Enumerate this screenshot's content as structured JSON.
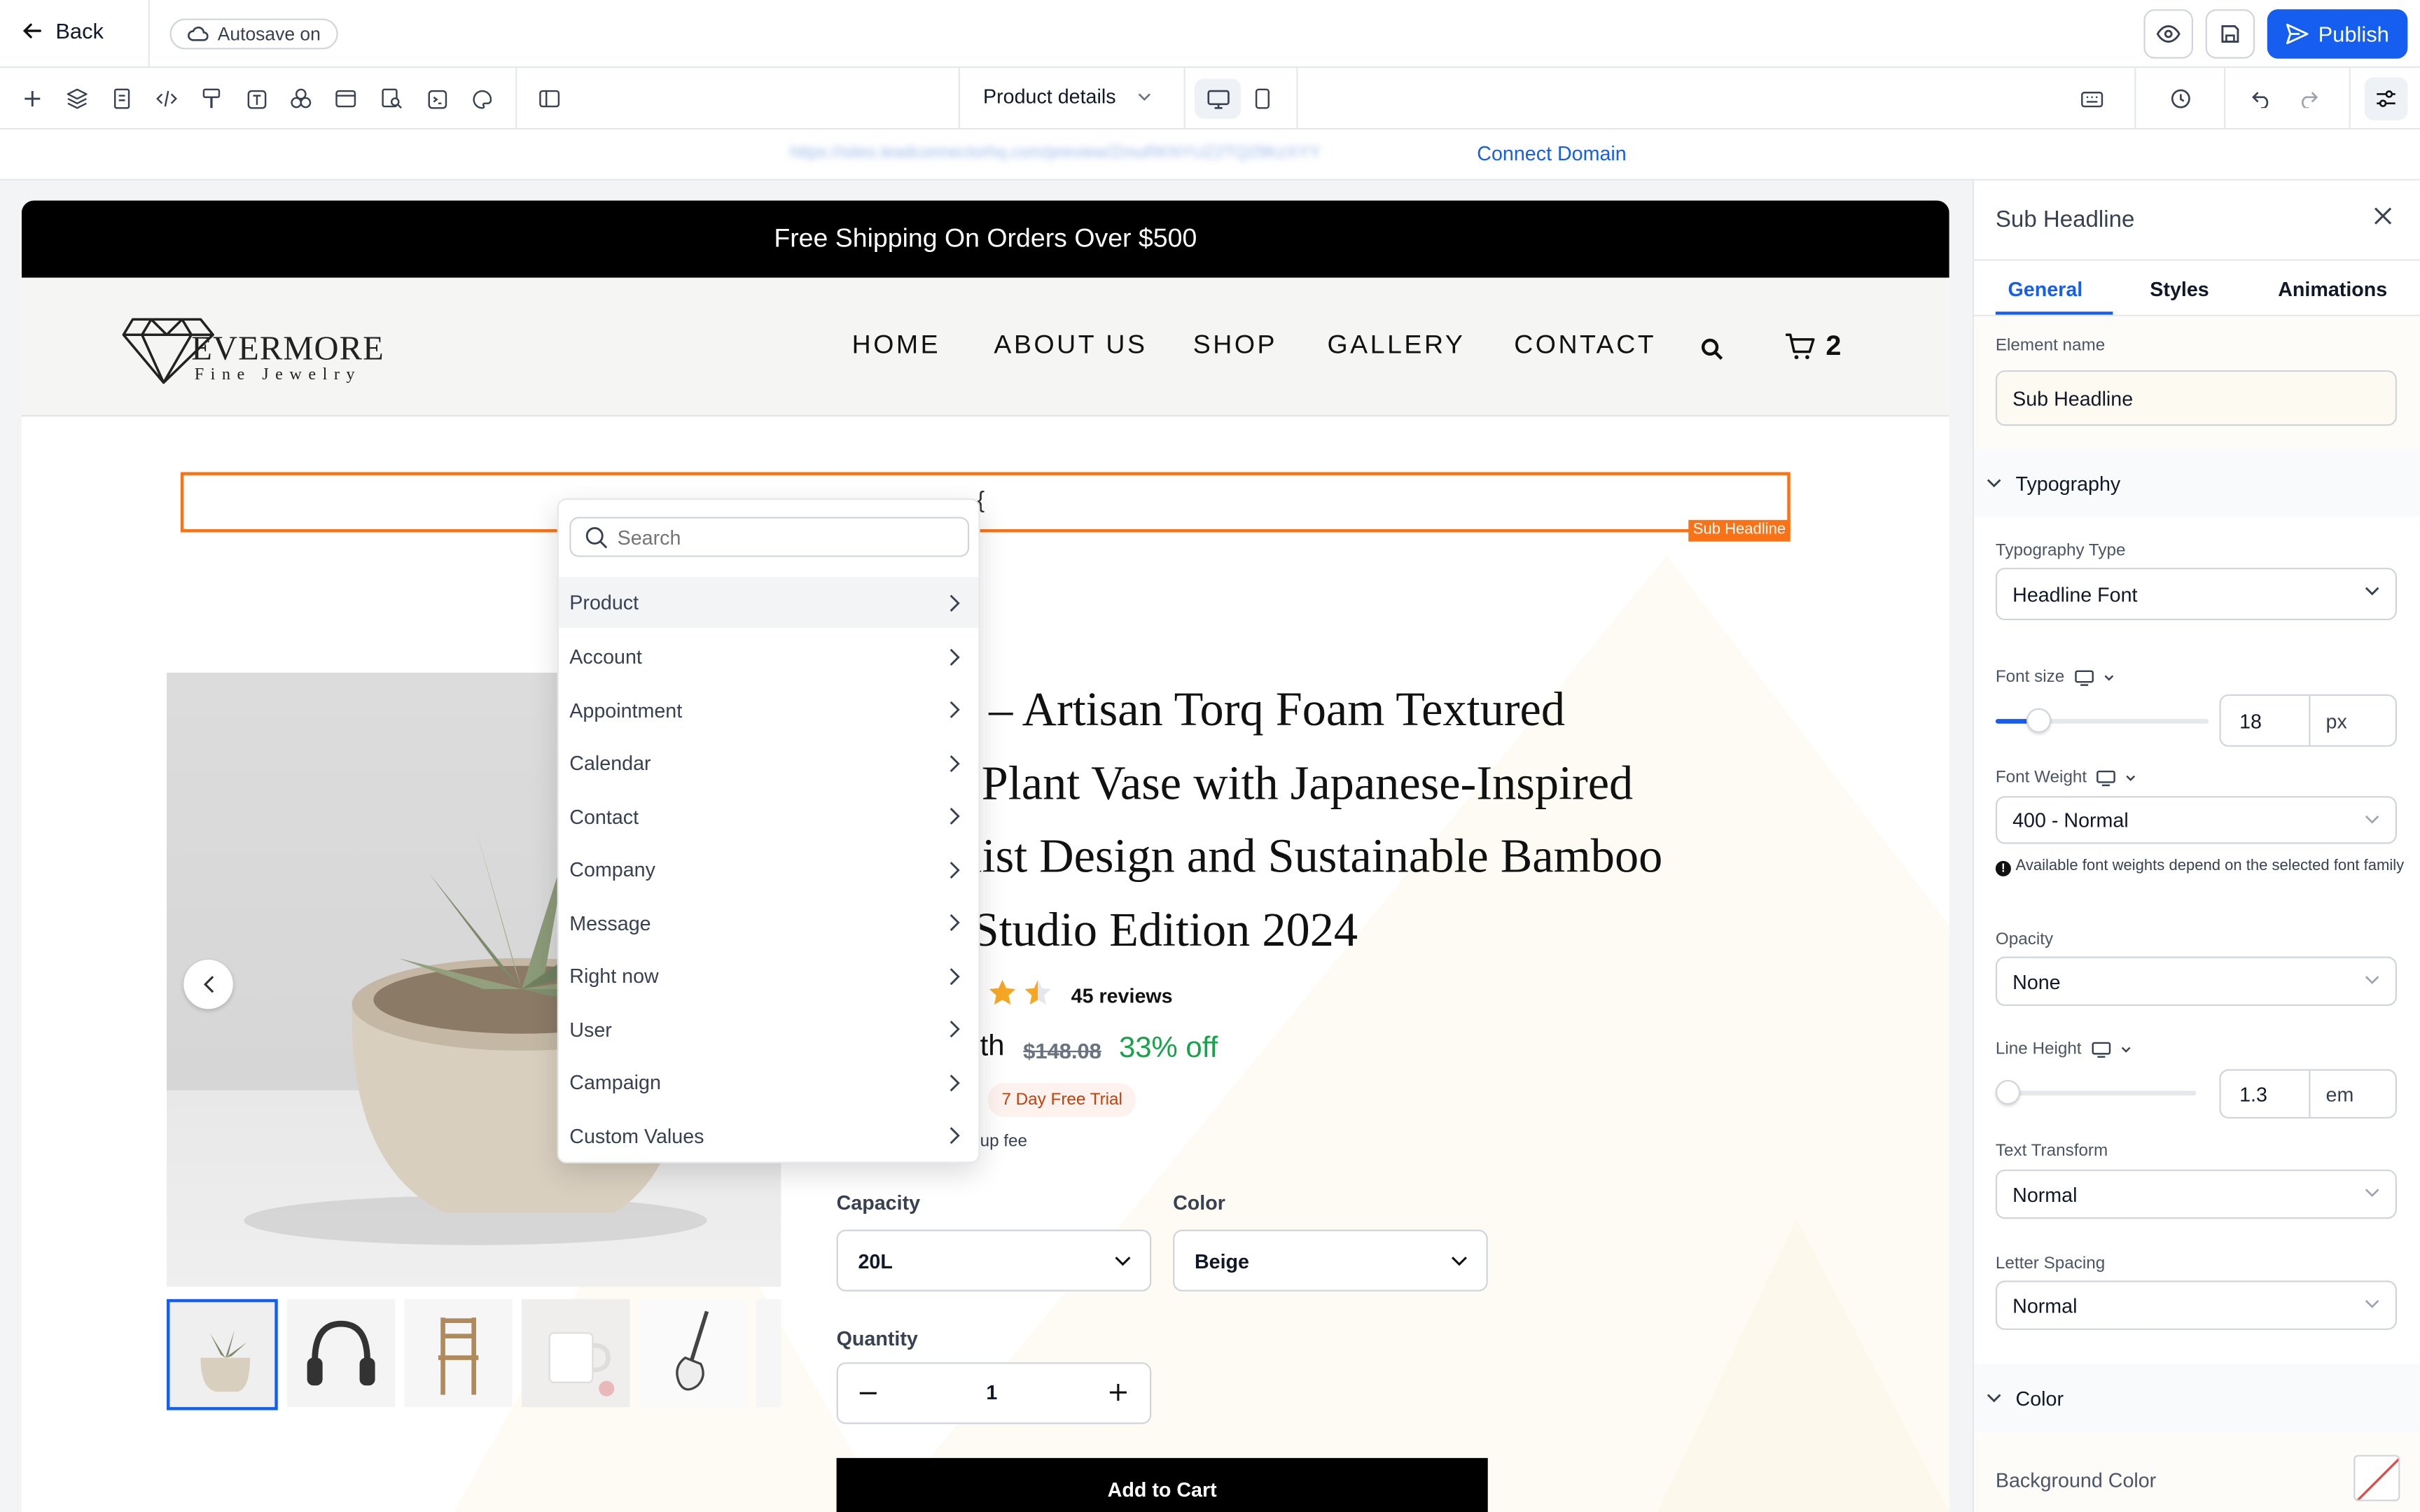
{
  "topbar": {
    "back_label": "Back",
    "autosave_label": "Autosave on",
    "publish_label": "Publish"
  },
  "toolbar": {
    "page_select": "Product details"
  },
  "urlbar": {
    "url_text": "https://sites.leadconnectorhq.com/preview/ZmuRKNYUZ2TQ29KzXYY",
    "connect_label": "Connect Domain"
  },
  "site": {
    "announcement": "Free Shipping On Orders Over $500",
    "logo": {
      "brand": "EVERMORE",
      "tagline": "Fine Jewelry"
    },
    "nav": [
      "HOME",
      "ABOUT US",
      "SHOP",
      "GALLERY",
      "CONTACT"
    ],
    "cart_count": "2",
    "sub_headline_text": "{",
    "sub_headline_tag": "Sub Headline",
    "product": {
      "title_lines": [
        "rt – Artisan Torq Foam Textured",
        "Plant Vase with Japanese-Inspired",
        "alist Design and Sustainable Bamboo",
        "Studio Edition 2024"
      ],
      "rating": 4.5,
      "reviews": "45 reviews",
      "price_suffix": "th",
      "compare_price": "$148.08",
      "discount": "33% off",
      "trial_badge": "7 Day Free Trial",
      "setup_fee": "up fee",
      "capacity_label": "Capacity",
      "capacity_value": "20L",
      "color_label": "Color",
      "color_value": "Beige",
      "quantity_label": "Quantity",
      "quantity_value": "1",
      "add_to_cart": "Add to Cart"
    }
  },
  "dropdown": {
    "search_placeholder": "Search",
    "items": [
      "Product",
      "Account",
      "Appointment",
      "Calendar",
      "Contact",
      "Company",
      "Message",
      "Right now",
      "User",
      "Campaign",
      "Custom Values"
    ]
  },
  "panel": {
    "title": "Sub Headline",
    "tabs": [
      "General",
      "Styles",
      "Animations"
    ],
    "element_name_label": "Element name",
    "element_name_value": "Sub Headline",
    "typography_heading": "Typography",
    "typography_type_label": "Typography Type",
    "typography_type_value": "Headline Font",
    "font_size_label": "Font size",
    "font_size_value": "18",
    "font_size_unit": "px",
    "font_size_slider": 0.2,
    "font_weight_label": "Font Weight",
    "font_weight_value": "400 - Normal",
    "font_weight_note": "Available font weights depend on the selected font family",
    "opacity_label": "Opacity",
    "opacity_value": "None",
    "line_height_label": "Line Height",
    "line_height_value": "1.3",
    "line_height_unit": "em",
    "line_height_slider": 0.0,
    "text_transform_label": "Text Transform",
    "text_transform_value": "Normal",
    "letter_spacing_label": "Letter Spacing",
    "letter_spacing_value": "Normal",
    "color_heading": "Color",
    "background_color_label": "Background Color"
  },
  "colors": {
    "accent": "#155eef",
    "selection": "#f97316",
    "discount": "#16a34a",
    "star": "#f5a623",
    "trial_bg": "#fef2ee",
    "trial_text": "#c2410c"
  }
}
